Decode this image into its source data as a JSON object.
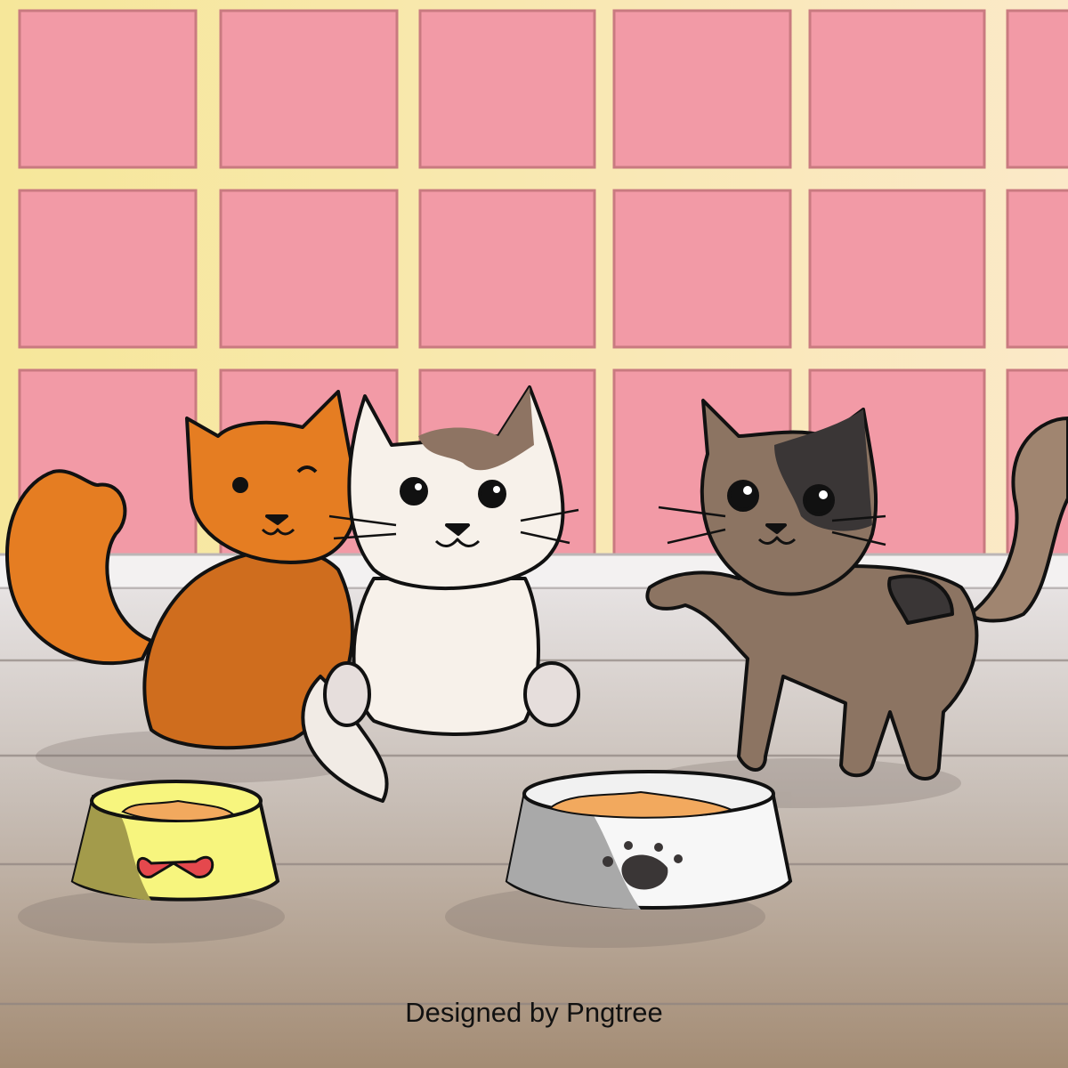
{
  "scene": {
    "description_tags": [
      "orange-cat",
      "white-cat",
      "brown-cat",
      "yellow-bowl",
      "gray-bowl"
    ],
    "colors": {
      "wall": "#f6e79a",
      "tile": "#f29aa6",
      "baseboard": "#f3f1f1",
      "floor_top": "#e4e0df",
      "floor_bottom": "#a48c74",
      "orange_cat": "#e57d22",
      "white_cat": "#f7f1ea",
      "brown_cat": "#8c7462",
      "yellow_bowl": "#f7f57e",
      "gray_bowl": "#e6e6e6",
      "food": "#f2a95e",
      "bow": "#e5484d"
    }
  },
  "credit": {
    "text": "Designed by Pngtree"
  }
}
